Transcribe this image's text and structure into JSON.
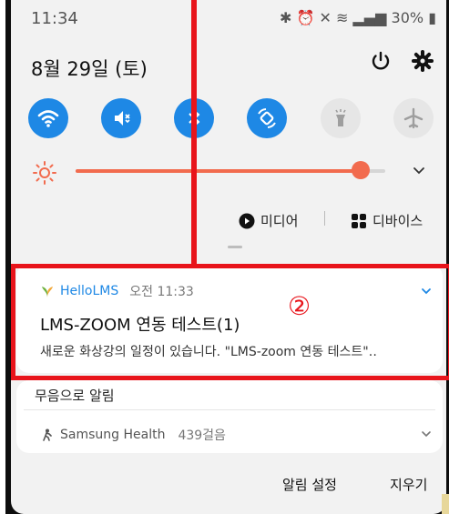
{
  "status": {
    "time": "11:34",
    "battery": "30%",
    "icons": [
      "bluetooth-icon",
      "alarm-icon",
      "mute-icon",
      "wifi-icon",
      "signal-icon",
      "battery-icon"
    ]
  },
  "header": {
    "date": "8월 29일 (토)"
  },
  "quick_settings": {
    "tiles": [
      {
        "name": "wifi",
        "state": "on",
        "icon": "wifi-icon"
      },
      {
        "name": "mute",
        "state": "on",
        "icon": "mute-icon"
      },
      {
        "name": "bluetooth",
        "state": "on",
        "icon": "bluetooth-icon"
      },
      {
        "name": "auto-rotate",
        "state": "on",
        "icon": "auto-rotate-icon"
      },
      {
        "name": "flashlight",
        "state": "off",
        "icon": "flashlight-icon"
      },
      {
        "name": "airplane",
        "state": "off",
        "icon": "airplane-icon"
      }
    ],
    "brightness_level": 0.92
  },
  "media": {
    "media_label": "미디어",
    "device_label": "디바이스"
  },
  "notification": {
    "app_name": "HelloLMS",
    "time": "오전 11:33",
    "title": "LMS-ZOOM 연동 테스트(1)",
    "body": "새로운 화상강의 일정이 있습니다. \"LMS-zoom 연동 테스트\"‥",
    "annotation": "②"
  },
  "silent": {
    "header": "무음으로 알림",
    "app": "Samsung Health",
    "detail": "439걸음"
  },
  "actions": {
    "settings": "알림 설정",
    "clear": "지우기"
  },
  "colors": {
    "accent": "#1e88e5",
    "highlight": "#e8141b",
    "brightness": "#f26b4e"
  }
}
